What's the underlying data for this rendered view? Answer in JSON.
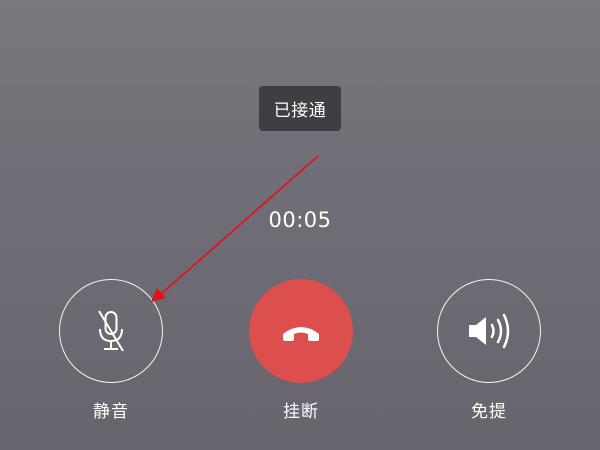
{
  "toast": {
    "text": "已接通"
  },
  "call": {
    "duration": "00:05"
  },
  "controls": {
    "mute": {
      "label": "静音",
      "icon": "microphone-muted-icon"
    },
    "hangup": {
      "label": "挂断",
      "icon": "phone-hangup-icon",
      "color": "#dd4f4d"
    },
    "speaker": {
      "label": "免提",
      "icon": "speaker-icon"
    }
  },
  "annotation": {
    "color": "#e0141c"
  }
}
